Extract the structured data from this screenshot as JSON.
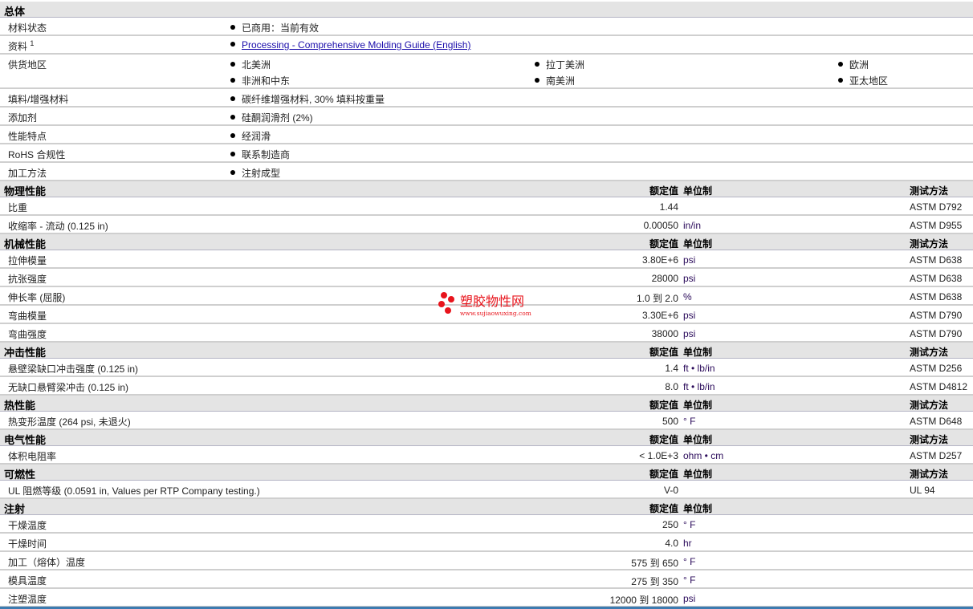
{
  "general": {
    "title": "总体",
    "rows": [
      {
        "label": "材料状态",
        "values": [
          "已商用：当前有效"
        ]
      },
      {
        "label": "资料",
        "sup": "1",
        "link": "Processing - Comprehensive Molding Guide (English)"
      },
      {
        "label": "供货地区",
        "values": [
          "北美洲",
          "拉丁美洲",
          "欧洲",
          "非洲和中东",
          "南美洲",
          "亚太地区"
        ]
      },
      {
        "label": "填料/增强材料",
        "values": [
          "碳纤维增强材料, 30% 填料按重量"
        ]
      },
      {
        "label": "添加剂",
        "values": [
          "硅酮润滑剂 (2%)"
        ]
      },
      {
        "label": "性能特点",
        "values": [
          "经润滑"
        ]
      },
      {
        "label": "RoHS 合规性",
        "values": [
          "联系制造商"
        ]
      },
      {
        "label": "加工方法",
        "values": [
          "注射成型"
        ]
      }
    ]
  },
  "columns": {
    "value": "额定值",
    "unit": "单位制",
    "method": "测试方法"
  },
  "sections": [
    {
      "title": "物理性能",
      "method_col": true,
      "rows": [
        {
          "label": "比重",
          "value": "1.44",
          "unit": "",
          "method": "ASTM D792"
        },
        {
          "label": "收缩率 - 流动 (0.125 in)",
          "value": "0.00050",
          "unit": "in/in",
          "method": "ASTM D955"
        }
      ]
    },
    {
      "title": "机械性能",
      "method_col": true,
      "rows": [
        {
          "label": "拉伸模量",
          "value": "3.80E+6",
          "unit": "psi",
          "method": "ASTM D638"
        },
        {
          "label": "抗张强度",
          "value": "28000",
          "unit": "psi",
          "method": "ASTM D638"
        },
        {
          "label": "伸长率 (屈服)",
          "value": "1.0 到 2.0",
          "unit": "%",
          "method": "ASTM D638"
        },
        {
          "label": "弯曲模量",
          "value": "3.30E+6",
          "unit": "psi",
          "method": "ASTM D790"
        },
        {
          "label": "弯曲强度",
          "value": "38000",
          "unit": "psi",
          "method": "ASTM D790"
        }
      ]
    },
    {
      "title": "冲击性能",
      "method_col": true,
      "rows": [
        {
          "label": "悬壁梁缺口冲击强度 (0.125 in)",
          "value": "1.4",
          "unit": "ft • lb/in",
          "method": "ASTM D256"
        },
        {
          "label": "无缺口悬臂梁冲击 (0.125 in)",
          "value": "8.0",
          "unit": "ft • lb/in",
          "method": "ASTM D4812"
        }
      ]
    },
    {
      "title": "热性能",
      "method_col": true,
      "rows": [
        {
          "label": "热变形温度 (264 psi, 未退火)",
          "value": "500",
          "unit": "° F",
          "method": "ASTM D648"
        }
      ]
    },
    {
      "title": "电气性能",
      "method_col": true,
      "rows": [
        {
          "label": "体积电阻率",
          "value": "< 1.0E+3",
          "unit": "ohm • cm",
          "method": "ASTM D257"
        }
      ]
    },
    {
      "title": "可燃性",
      "method_col": true,
      "rows": [
        {
          "label": "UL 阻燃等级 (0.0591 in, Values per RTP Company testing.)",
          "value": "V-0",
          "unit": "",
          "method": "UL 94"
        }
      ]
    },
    {
      "title": "注射",
      "method_col": false,
      "rows": [
        {
          "label": "干燥温度",
          "value": "250",
          "unit": "° F",
          "method": ""
        },
        {
          "label": "干燥时间",
          "value": "4.0",
          "unit": "hr",
          "method": ""
        },
        {
          "label": "加工（熔体）温度",
          "value": "575 到 650",
          "unit": "° F",
          "method": ""
        },
        {
          "label": "模具温度",
          "value": "275 到 350",
          "unit": "° F",
          "method": ""
        },
        {
          "label": "注塑温度",
          "value": "12000 到 18000",
          "unit": "psi",
          "method": ""
        }
      ]
    }
  ],
  "watermark": {
    "name": "塑胶物性网",
    "url": "www.sujiaowuxing.com"
  }
}
